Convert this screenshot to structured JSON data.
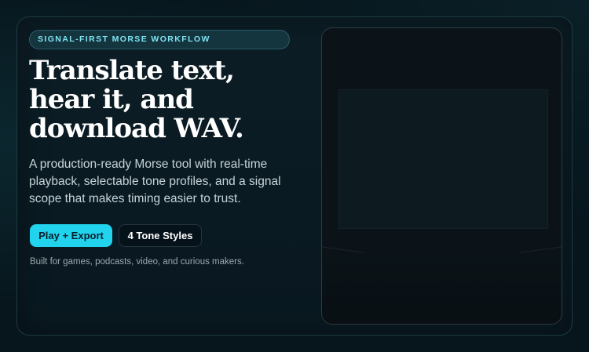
{
  "hero": {
    "eyebrow": "SIGNAL-FIRST MORSE WORKFLOW",
    "headline": "Translate text, hear it, and download WAV.",
    "subtitle": "A production-ready Morse tool with real-time playback, selectable tone profiles, and a signal scope that makes timing easier to trust.",
    "primary_button": "Play + Export",
    "secondary_button": "4 Tone Styles",
    "footnote": "Built for games, podcasts, video, and curious makers."
  },
  "colors": {
    "accent": "#22d3ee",
    "eyebrow_text": "#7fe3f2",
    "background": "#07161d"
  }
}
